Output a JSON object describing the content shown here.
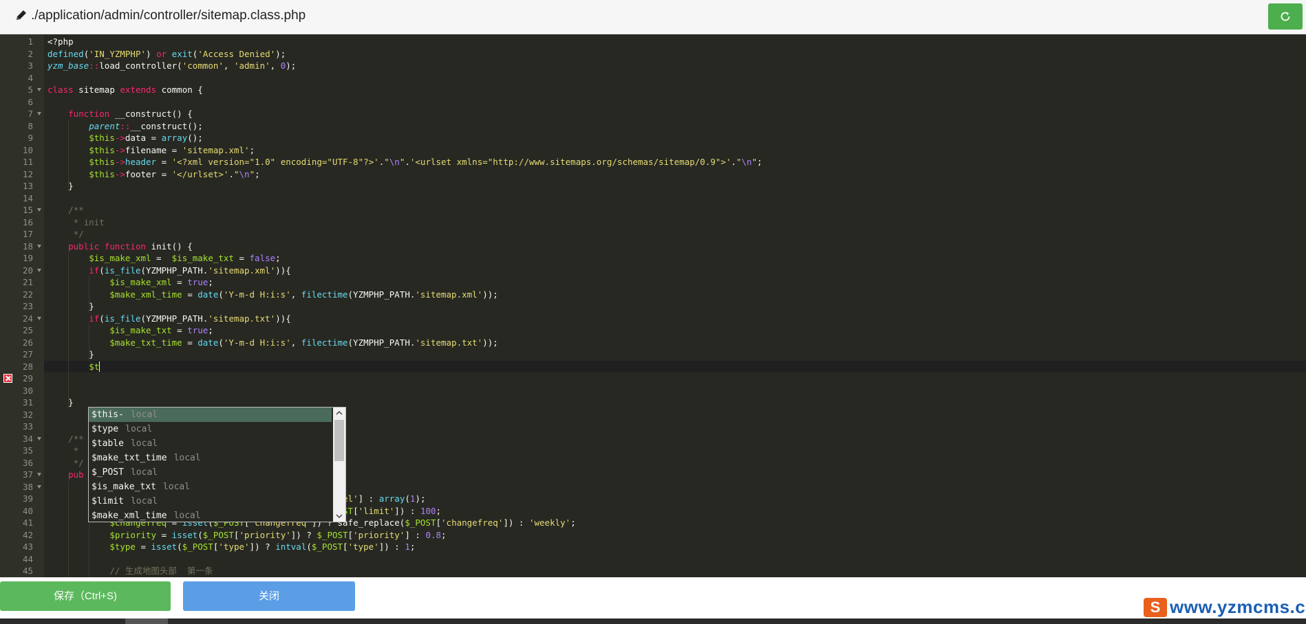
{
  "header": {
    "file_path": "./application/admin/controller/sitemap.class.php",
    "edit_icon": "pencil-icon",
    "refresh_icon": "refresh-icon"
  },
  "editor": {
    "theme_colors": {
      "background": "#272822",
      "keyword": "#f92672",
      "string": "#e6db74",
      "number": "#ae81ff",
      "function": "#66d9ef",
      "variable": "#a6e22e",
      "comment": "#75715e"
    },
    "error_line": 29,
    "active_line": 28,
    "lines": [
      {
        "n": 1,
        "fold": false,
        "t": [
          [
            "",
            "<?php"
          ]
        ]
      },
      {
        "n": 2,
        "fold": false,
        "t": [
          [
            "fn",
            "defined"
          ],
          [
            "",
            "("
          ],
          [
            "st",
            "'IN_YZMPHP'"
          ],
          [
            "",
            ") "
          ],
          [
            "kw",
            "or"
          ],
          [
            "",
            "",
            " "
          ],
          [
            "fn",
            "exit"
          ],
          [
            "",
            "("
          ],
          [
            "st",
            "'Access Denied'"
          ],
          [
            "",
            ");"
          ]
        ]
      },
      {
        "n": 3,
        "fold": false,
        "t": [
          [
            "fi",
            "yzm_base"
          ],
          [
            "op",
            "::"
          ],
          [
            "",
            "load_controller("
          ],
          [
            "st",
            "'common'"
          ],
          [
            "",
            ", "
          ],
          [
            "st",
            "'admin'"
          ],
          [
            "",
            ", "
          ],
          [
            "nu",
            "0"
          ],
          [
            "",
            ");"
          ]
        ]
      },
      {
        "n": 4,
        "fold": false,
        "t": []
      },
      {
        "n": 5,
        "fold": true,
        "t": [
          [
            "kw",
            "class"
          ],
          [
            "",
            " sitemap "
          ],
          [
            "kw",
            "extends"
          ],
          [
            "",
            " common {"
          ]
        ]
      },
      {
        "n": 6,
        "fold": false,
        "t": []
      },
      {
        "n": 7,
        "fold": true,
        "t": [
          [
            "",
            "    "
          ],
          [
            "kw",
            "function"
          ],
          [
            "",
            " __construct() {"
          ]
        ]
      },
      {
        "n": 8,
        "fold": false,
        "t": [
          [
            "",
            "        "
          ],
          [
            "fi",
            "parent"
          ],
          [
            "op",
            "::"
          ],
          [
            "",
            "__construct();"
          ]
        ]
      },
      {
        "n": 9,
        "fold": false,
        "t": [
          [
            "",
            "        "
          ],
          [
            "va",
            "$this"
          ],
          [
            "op",
            "->"
          ],
          [
            "",
            "data = "
          ],
          [
            "fn",
            "array"
          ],
          [
            "",
            "();"
          ]
        ]
      },
      {
        "n": 10,
        "fold": false,
        "t": [
          [
            "",
            "        "
          ],
          [
            "va",
            "$this"
          ],
          [
            "op",
            "->"
          ],
          [
            "",
            "filename = "
          ],
          [
            "st",
            "'sitemap.xml'"
          ],
          [
            "",
            ";"
          ]
        ]
      },
      {
        "n": 11,
        "fold": false,
        "t": [
          [
            "",
            "        "
          ],
          [
            "va",
            "$this"
          ],
          [
            "op",
            "->"
          ],
          [
            "fn",
            "header"
          ],
          [
            "",
            " = "
          ],
          [
            "st",
            "'<?xml version=\"1.0\" encoding=\"UTF-8\"?>'"
          ],
          [
            "",
            "."
          ],
          [
            "st",
            "\""
          ],
          [
            "ct",
            "\\n"
          ],
          [
            "st",
            "\""
          ],
          [
            "",
            "."
          ],
          [
            "st",
            "'<urlset xmlns=\"http://www.sitemaps.org/schemas/sitemap/0.9\">'"
          ],
          [
            "",
            "."
          ],
          [
            "st",
            "\""
          ],
          [
            "ct",
            "\\n"
          ],
          [
            "st",
            "\""
          ],
          [
            "",
            ";"
          ]
        ]
      },
      {
        "n": 12,
        "fold": false,
        "t": [
          [
            "",
            "        "
          ],
          [
            "va",
            "$this"
          ],
          [
            "op",
            "->"
          ],
          [
            "",
            "footer = "
          ],
          [
            "st",
            "'</urlset>'"
          ],
          [
            "",
            "."
          ],
          [
            "st",
            "\""
          ],
          [
            "ct",
            "\\n"
          ],
          [
            "st",
            "\""
          ],
          [
            "",
            ";"
          ]
        ]
      },
      {
        "n": 13,
        "fold": false,
        "t": [
          [
            "",
            "    }"
          ]
        ]
      },
      {
        "n": 14,
        "fold": false,
        "t": []
      },
      {
        "n": 15,
        "fold": true,
        "t": [
          [
            "",
            "    "
          ],
          [
            "co",
            "/**"
          ]
        ]
      },
      {
        "n": 16,
        "fold": false,
        "t": [
          [
            "",
            "     "
          ],
          [
            "co",
            "* init"
          ]
        ]
      },
      {
        "n": 17,
        "fold": false,
        "t": [
          [
            "",
            "     "
          ],
          [
            "co",
            "*/"
          ]
        ]
      },
      {
        "n": 18,
        "fold": true,
        "t": [
          [
            "",
            "    "
          ],
          [
            "kw",
            "public"
          ],
          [
            "",
            "",
            " "
          ],
          [
            "kw",
            "function"
          ],
          [
            "",
            " init() {"
          ]
        ]
      },
      {
        "n": 19,
        "fold": false,
        "t": [
          [
            "",
            "        "
          ],
          [
            "va",
            "$is_make_xml"
          ],
          [
            "",
            " =  "
          ],
          [
            "va",
            "$is_make_txt"
          ],
          [
            "",
            " = "
          ],
          [
            "nu",
            "false"
          ],
          [
            "",
            ";"
          ]
        ]
      },
      {
        "n": 20,
        "fold": true,
        "t": [
          [
            "",
            "        "
          ],
          [
            "kw",
            "if"
          ],
          [
            "",
            "("
          ],
          [
            "fn",
            "is_file"
          ],
          [
            "",
            "(YZMPHP_PATH."
          ],
          [
            "st",
            "'sitemap.xml'"
          ],
          [
            "",
            ")){"
          ]
        ]
      },
      {
        "n": 21,
        "fold": false,
        "t": [
          [
            "",
            "            "
          ],
          [
            "va",
            "$is_make_xml"
          ],
          [
            "",
            " = "
          ],
          [
            "nu",
            "true"
          ],
          [
            "",
            ";"
          ]
        ]
      },
      {
        "n": 22,
        "fold": false,
        "t": [
          [
            "",
            "            "
          ],
          [
            "va",
            "$make_xml_time"
          ],
          [
            "",
            " = "
          ],
          [
            "fn",
            "date"
          ],
          [
            "",
            "("
          ],
          [
            "st",
            "'Y-m-d H:i:s'"
          ],
          [
            "",
            ", "
          ],
          [
            "fn",
            "filectime"
          ],
          [
            "",
            "(YZMPHP_PATH."
          ],
          [
            "st",
            "'sitemap.xml'"
          ],
          [
            "",
            "));"
          ]
        ]
      },
      {
        "n": 23,
        "fold": false,
        "t": [
          [
            "",
            "        }"
          ]
        ]
      },
      {
        "n": 24,
        "fold": true,
        "t": [
          [
            "",
            "        "
          ],
          [
            "kw",
            "if"
          ],
          [
            "",
            "("
          ],
          [
            "fn",
            "is_file"
          ],
          [
            "",
            "(YZMPHP_PATH."
          ],
          [
            "st",
            "'sitemap.txt'"
          ],
          [
            "",
            ")){"
          ]
        ]
      },
      {
        "n": 25,
        "fold": false,
        "t": [
          [
            "",
            "            "
          ],
          [
            "va",
            "$is_make_txt"
          ],
          [
            "",
            " = "
          ],
          [
            "nu",
            "true"
          ],
          [
            "",
            ";"
          ]
        ]
      },
      {
        "n": 26,
        "fold": false,
        "t": [
          [
            "",
            "            "
          ],
          [
            "va",
            "$make_txt_time"
          ],
          [
            "",
            " = "
          ],
          [
            "fn",
            "date"
          ],
          [
            "",
            "("
          ],
          [
            "st",
            "'Y-m-d H:i:s'"
          ],
          [
            "",
            ", "
          ],
          [
            "fn",
            "filectime"
          ],
          [
            "",
            "(YZMPHP_PATH."
          ],
          [
            "st",
            "'sitemap.txt'"
          ],
          [
            "",
            "));"
          ]
        ]
      },
      {
        "n": 27,
        "fold": false,
        "t": [
          [
            "",
            "        }"
          ]
        ]
      },
      {
        "n": 28,
        "fold": false,
        "t": [
          [
            "",
            "        "
          ],
          [
            "va",
            "$t"
          ]
        ],
        "cursor": true
      },
      {
        "n": 29,
        "fold": false,
        "t": []
      },
      {
        "n": 30,
        "fold": false,
        "t": []
      },
      {
        "n": 31,
        "fold": false,
        "t": [
          [
            "",
            "    }"
          ]
        ]
      },
      {
        "n": 32,
        "fold": false,
        "t": []
      },
      {
        "n": 33,
        "fold": false,
        "t": []
      },
      {
        "n": 34,
        "fold": true,
        "t": [
          [
            "",
            "    "
          ],
          [
            "co",
            "/**"
          ]
        ]
      },
      {
        "n": 35,
        "fold": false,
        "t": [
          [
            "",
            "     "
          ],
          [
            "co",
            "*"
          ]
        ]
      },
      {
        "n": 36,
        "fold": false,
        "t": [
          [
            "",
            "     "
          ],
          [
            "co",
            "*/"
          ]
        ]
      },
      {
        "n": 37,
        "fold": true,
        "t": [
          [
            "",
            "    "
          ],
          [
            "kw",
            "pub"
          ]
        ]
      },
      {
        "n": 38,
        "fold": true,
        "t": []
      },
      {
        "n": 39,
        "fold": false,
        "t": [
          [
            "",
            "            "
          ],
          [
            "va",
            "$model"
          ],
          [
            "",
            " = "
          ],
          [
            "fn",
            "isset"
          ],
          [
            "",
            "("
          ],
          [
            "va",
            "$_POST"
          ],
          [
            "",
            "["
          ],
          [
            "st",
            "'model'"
          ],
          [
            "",
            "]) ? "
          ],
          [
            "va",
            "$_POST"
          ],
          [
            "",
            "["
          ],
          [
            "st",
            "'model'"
          ],
          [
            "",
            "] : "
          ],
          [
            "fn",
            "array"
          ],
          [
            "",
            "("
          ],
          [
            "nu",
            "1"
          ],
          [
            "",
            ");"
          ]
        ]
      },
      {
        "n": 40,
        "fold": false,
        "t": [
          [
            "",
            "            "
          ],
          [
            "va",
            "$limit"
          ],
          [
            "",
            " = "
          ],
          [
            "fn",
            "isset"
          ],
          [
            "",
            "("
          ],
          [
            "va",
            "$_POST"
          ],
          [
            "",
            "["
          ],
          [
            "st",
            "'limit'"
          ],
          [
            "",
            "]) ? "
          ],
          [
            "fn",
            "intval"
          ],
          [
            "",
            "("
          ],
          [
            "va",
            "$_POST"
          ],
          [
            "",
            "["
          ],
          [
            "st",
            "'limit'"
          ],
          [
            "",
            "]) : "
          ],
          [
            "nu",
            "100"
          ],
          [
            "",
            ";"
          ]
        ]
      },
      {
        "n": 41,
        "fold": false,
        "t": [
          [
            "",
            "            "
          ],
          [
            "va",
            "$changefreq"
          ],
          [
            "",
            " = "
          ],
          [
            "fn",
            "isset"
          ],
          [
            "",
            "("
          ],
          [
            "va",
            "$_POST"
          ],
          [
            "",
            "["
          ],
          [
            "st",
            "'changefreq'"
          ],
          [
            "",
            "]) ? safe_replace("
          ],
          [
            "va",
            "$_POST"
          ],
          [
            "",
            "["
          ],
          [
            "st",
            "'changefreq'"
          ],
          [
            "",
            "]) : "
          ],
          [
            "st",
            "'weekly'"
          ],
          [
            "",
            ";"
          ]
        ]
      },
      {
        "n": 42,
        "fold": false,
        "t": [
          [
            "",
            "            "
          ],
          [
            "va",
            "$priority"
          ],
          [
            "",
            " = "
          ],
          [
            "fn",
            "isset"
          ],
          [
            "",
            "("
          ],
          [
            "va",
            "$_POST"
          ],
          [
            "",
            "["
          ],
          [
            "st",
            "'priority'"
          ],
          [
            "",
            "]) ? "
          ],
          [
            "va",
            "$_POST"
          ],
          [
            "",
            "["
          ],
          [
            "st",
            "'priority'"
          ],
          [
            "",
            "] : "
          ],
          [
            "nu",
            "0.8"
          ],
          [
            "",
            ";"
          ]
        ]
      },
      {
        "n": 43,
        "fold": false,
        "t": [
          [
            "",
            "            "
          ],
          [
            "va",
            "$type"
          ],
          [
            "",
            " = "
          ],
          [
            "fn",
            "isset"
          ],
          [
            "",
            "("
          ],
          [
            "va",
            "$_POST"
          ],
          [
            "",
            "["
          ],
          [
            "st",
            "'type'"
          ],
          [
            "",
            "]) ? "
          ],
          [
            "fn",
            "intval"
          ],
          [
            "",
            "("
          ],
          [
            "va",
            "$_POST"
          ],
          [
            "",
            "["
          ],
          [
            "st",
            "'type'"
          ],
          [
            "",
            "]) : "
          ],
          [
            "nu",
            "1"
          ],
          [
            "",
            ";"
          ]
        ]
      },
      {
        "n": 44,
        "fold": false,
        "t": []
      },
      {
        "n": 45,
        "fold": false,
        "t": [
          [
            "",
            "            "
          ],
          [
            "co",
            "// 生成地图头部  第一条"
          ]
        ]
      }
    ]
  },
  "autocomplete": {
    "items": [
      {
        "label": "$this-",
        "meta": "local",
        "selected": true
      },
      {
        "label": "$type",
        "meta": "local",
        "selected": false
      },
      {
        "label": "$table",
        "meta": "local",
        "selected": false
      },
      {
        "label": "$make_txt_time",
        "meta": "local",
        "selected": false
      },
      {
        "label": "$_POST",
        "meta": "local",
        "selected": false
      },
      {
        "label": "$is_make_txt",
        "meta": "local",
        "selected": false
      },
      {
        "label": "$limit",
        "meta": "local",
        "selected": false
      },
      {
        "label": "$make_xml_time",
        "meta": "local",
        "selected": false
      }
    ]
  },
  "footer": {
    "save_label": "保存（Ctrl+S)",
    "close_label": "关闭",
    "save_color": "#5cb85c",
    "close_color": "#5b9ee6"
  },
  "watermark": {
    "logo_letter": "S",
    "text": "www.yzmcms.com"
  }
}
